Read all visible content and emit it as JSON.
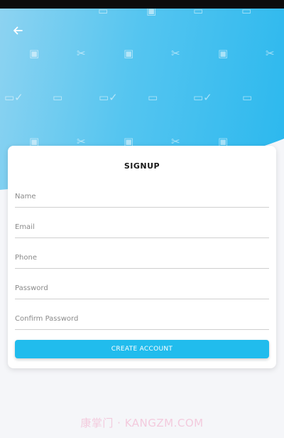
{
  "colors": {
    "status_bar": "#0c0c0c",
    "hero_gradient_start": "#8dd3f1",
    "hero_gradient_end": "#2bb8ee",
    "accent": "#21bced",
    "page_background": "#f5f6f9"
  },
  "header": {
    "back_icon": "arrow-left-icon",
    "pattern_icons": [
      "cart-icon",
      "scissors-icon",
      "credit-card-icon",
      "payment-check-icon"
    ]
  },
  "form": {
    "title": "SIGNUP",
    "fields": [
      {
        "name": "name",
        "placeholder": "Name",
        "value": ""
      },
      {
        "name": "email",
        "placeholder": "Email",
        "value": ""
      },
      {
        "name": "phone",
        "placeholder": "Phone",
        "value": ""
      },
      {
        "name": "password",
        "placeholder": "Password",
        "value": ""
      },
      {
        "name": "confirm_password",
        "placeholder": "Confirm Password",
        "value": ""
      }
    ],
    "submit_label": "CREATE ACCOUNT"
  },
  "watermark": "康掌门 · KANGZM.COM"
}
